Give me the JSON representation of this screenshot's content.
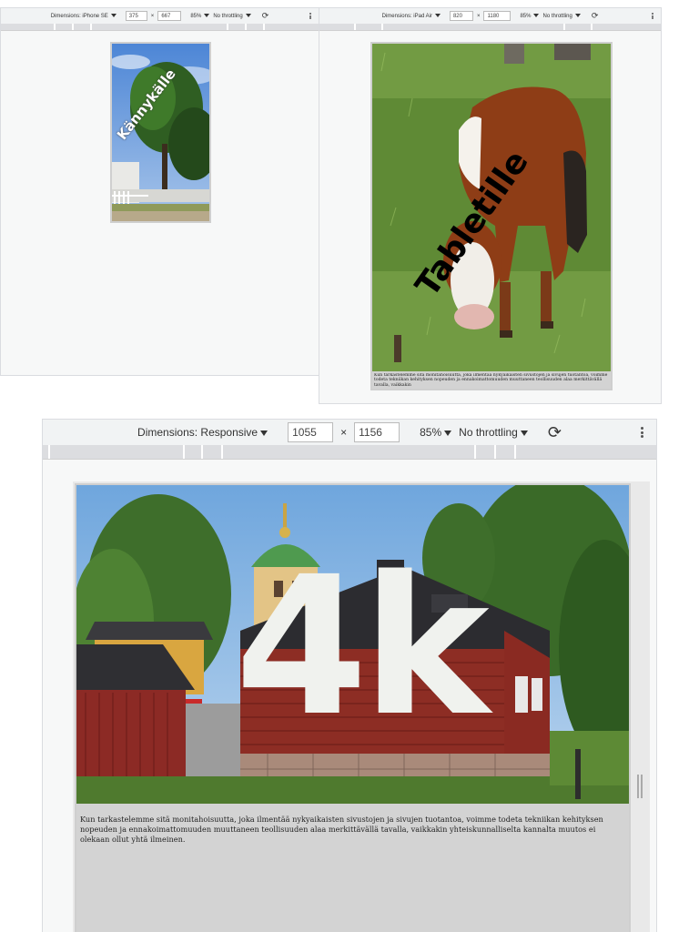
{
  "phone_panel": {
    "dimensions_label": "Dimensions: iPhone SE",
    "width": "375",
    "times": "×",
    "height": "667",
    "zoom": "85%",
    "throttle": "No throttling",
    "watermark": "Kännykälle"
  },
  "tablet_panel": {
    "dimensions_label": "Dimensions: iPad Air",
    "width": "820",
    "times": "×",
    "height": "1180",
    "zoom": "85%",
    "throttle": "No throttling",
    "watermark": "Tabletille",
    "caption": "Kun tarkastelemme sitä monitahoisuutta, joka ilmentää nykyaikaisten sivustojen ja sivujen tuotantoa, voimme todeta tekniikan kehityksen nopeuden ja ennakoimattomuuden muuttaneen teollisuuden alaa merkittävällä tavalla, vaikkakin"
  },
  "desktop_panel": {
    "dimensions_label": "Dimensions: Responsive",
    "width": "1055",
    "times": "×",
    "height": "1156",
    "zoom": "85%",
    "throttle": "No throttling",
    "watermark": "4k",
    "caption": "Kun tarkastelemme sitä monitahoisuutta, joka ilmentää nykyaikaisten sivustojen ja sivujen tuotantoa, voimme todeta tekniikan kehityksen nopeuden ja ennakoimattomuuden muuttaneen teollisuuden alaa merkittävällä tavalla, vaikkakin yhteiskunnalliselta kannalta muutos ei olekaan ollut yhtä ilmeinen."
  },
  "colors": {
    "toolbar_bg": "#f1f3f4",
    "viewport_bg": "#f7f8f8",
    "caption_bg": "#d3d3d3",
    "watermark_light": "#f0f2ee",
    "watermark_dark": "#000000"
  },
  "icons": {
    "rotate": "rotate-icon",
    "more": "more-vert-icon"
  }
}
